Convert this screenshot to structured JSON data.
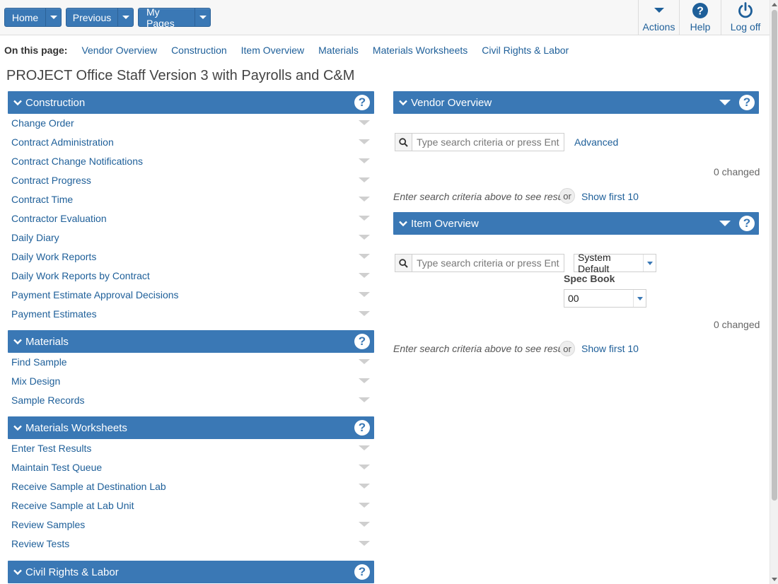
{
  "nav": {
    "home": "Home",
    "previous": "Previous",
    "my_pages": "My Pages",
    "actions": "Actions",
    "help": "Help",
    "logoff": "Log off"
  },
  "on_this_page": {
    "label": "On this page:",
    "links": [
      "Vendor Overview",
      "Construction",
      "Item Overview",
      "Materials",
      "Materials Worksheets",
      "Civil Rights & Labor"
    ]
  },
  "page_title": "PROJECT Office Staff Version 3 with Payrolls and C&M",
  "construction": {
    "title": "Construction",
    "items": [
      "Change Order",
      "Contract Administration",
      "Contract Change Notifications",
      "Contract Progress",
      "Contract Time",
      "Contractor Evaluation",
      "Daily Diary",
      "Daily Work Reports",
      "Daily Work Reports by Contract",
      "Payment Estimate Approval Decisions",
      "Payment Estimates"
    ]
  },
  "materials": {
    "title": "Materials",
    "items": [
      "Find Sample",
      "Mix Design",
      "Sample Records"
    ]
  },
  "materials_worksheets": {
    "title": "Materials Worksheets",
    "items": [
      "Enter Test Results",
      "Maintain Test Queue",
      "Receive Sample at Destination Lab",
      "Receive Sample at Lab Unit",
      "Review Samples",
      "Review Tests"
    ]
  },
  "civil_rights": {
    "title": "Civil Rights & Labor"
  },
  "vendor_overview": {
    "title": "Vendor Overview",
    "search_placeholder": "Type search criteria or press Enter",
    "advanced": "Advanced",
    "changed": "0 changed",
    "hint": "Enter search criteria above to see results",
    "or": "or",
    "show_first": "Show first 10"
  },
  "item_overview": {
    "title": "Item Overview",
    "search_placeholder": "Type search criteria or press Enter",
    "system_default": "System Default",
    "spec_book_label": "Spec Book",
    "spec_book_value": "00",
    "changed": "0 changed",
    "hint": "Enter search criteria above to see results",
    "or": "or",
    "show_first": "Show first 10"
  },
  "colors": {
    "header_blue": "#3a78b5",
    "link_blue": "#1e5f99"
  }
}
